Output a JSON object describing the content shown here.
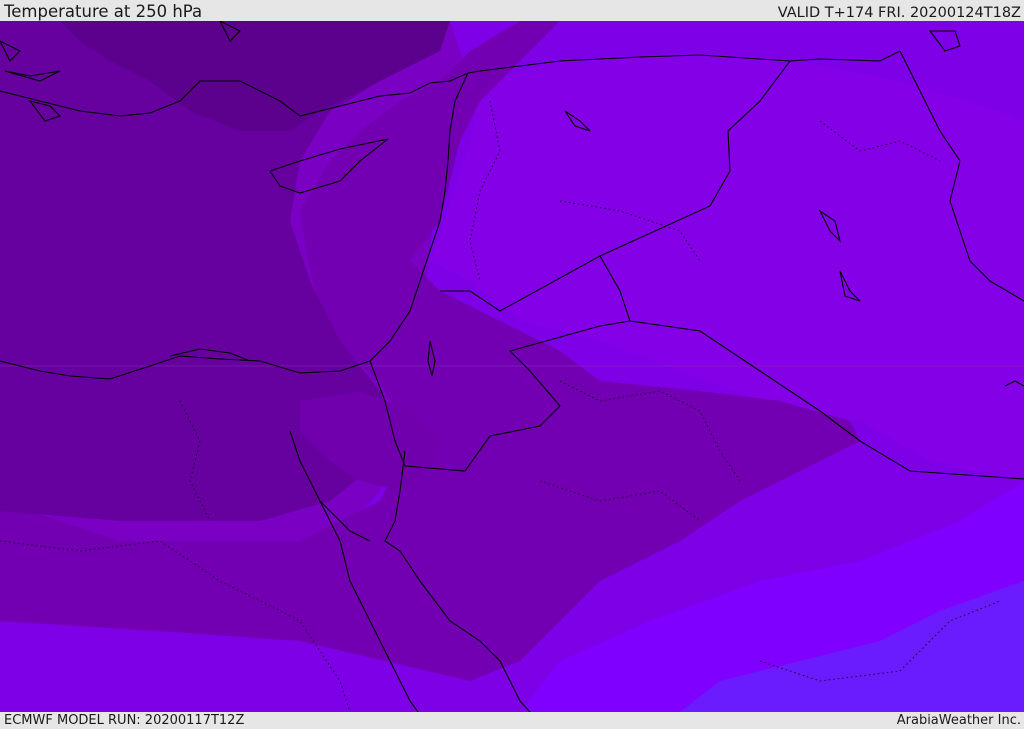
{
  "header": {
    "title": "Temperature at 250 hPa",
    "valid": "VALID T+174 FRI. 20200124T18Z"
  },
  "footer": {
    "model_run": "ECMWF MODEL RUN: 20200117T12Z",
    "credit": "ArabiaWeather Inc."
  },
  "colors": {
    "darkest": "#5a008a",
    "dark": "#66009e",
    "mid_dark": "#7200b2",
    "mid": "#7e00cc",
    "light": "#8600e6",
    "brightest": "#7d00ff",
    "blue_violet": "#6a1cff",
    "coast": "#000000"
  }
}
